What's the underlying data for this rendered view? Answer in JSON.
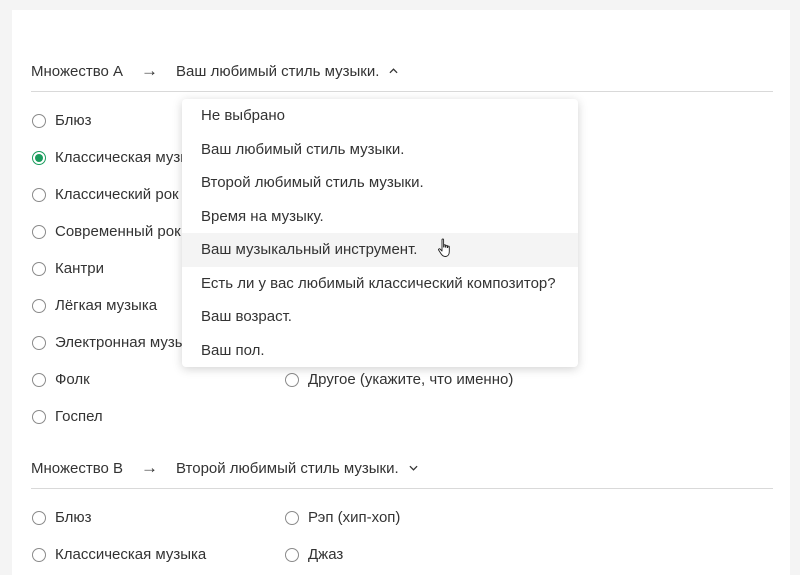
{
  "set_a": {
    "label": "Множество A",
    "arrow": "→",
    "selected": "Ваш любимый стиль музыки.",
    "options_col1": [
      "Блюз",
      "Классическая музыка",
      "Классический рок",
      "Современный рок",
      "Кантри",
      "Лёгкая музыка",
      "Электронная музыка",
      "Фолк",
      "Госпел"
    ],
    "options_col2_visible": [
      "Другое (укажите, что именно)"
    ],
    "checked": "Классическая музыка"
  },
  "dropdown": {
    "items": [
      "Не выбрано",
      "Ваш любимый стиль музыки.",
      "Второй любимый стиль музыки.",
      "Время на музыку.",
      "Ваш музыкальный инструмент.",
      "Есть ли у вас любимый классический композитор?",
      "Ваш возраст.",
      "Ваш пол."
    ],
    "hovered": "Ваш музыкальный инструмент."
  },
  "set_b": {
    "label": "Множество B",
    "arrow": "→",
    "selected": "Второй любимый стиль музыки.",
    "options_col1": [
      "Блюз",
      "Классическая музыка"
    ],
    "options_col2": [
      "Рэп (хип-хоп)",
      "Джаз"
    ]
  },
  "colors": {
    "accent": "#1a9c5d",
    "background": "#f4f4f4"
  },
  "icons": {
    "collapse": "chevron-up-icon",
    "expand": "chevron-down-icon",
    "cursor": "hand-pointer-icon"
  }
}
